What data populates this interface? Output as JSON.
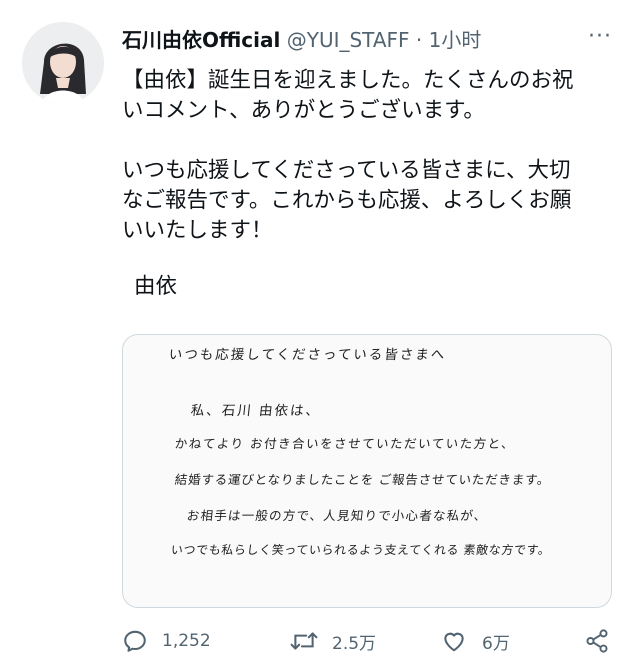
{
  "tweet": {
    "display_name": "石川由依Official",
    "handle": "@YUI_STAFF",
    "separator": "·",
    "time": "1小时",
    "more_label": "···",
    "body": {
      "line1": "【由依】誕生日を迎えました。たくさんのお祝",
      "line2": "いコメント、ありがとうございます。",
      "line3": "いつも応援してくださっている皆さまに、大切",
      "line4": "なご報告です。これからも応援、よろしくお願",
      "line5": "いいたします！",
      "signature": "由依"
    },
    "letter": {
      "l1": "いつも応援してくださっている皆さまへ",
      "l2": "私、石川 由依は、",
      "l3": "かねてより お付き合いをさせていただいていた方と、",
      "l4": "結婚する運びとなりましたことを ご報告させていただきます。",
      "l5": "お相手は一般の方で、人見知りで小心者な私が、",
      "l6": "いつでも私らしく笑っていられるよう支えてくれる 素敵な方です。"
    },
    "actions": {
      "replies": "1,252",
      "retweets": "2.5万",
      "likes": "6万"
    }
  },
  "colors": {
    "text": "#0f1419",
    "secondary": "#536471",
    "border": "#cfd9de"
  },
  "icons": [
    "reply-icon",
    "retweet-icon",
    "like-icon",
    "share-icon",
    "more-icon"
  ]
}
